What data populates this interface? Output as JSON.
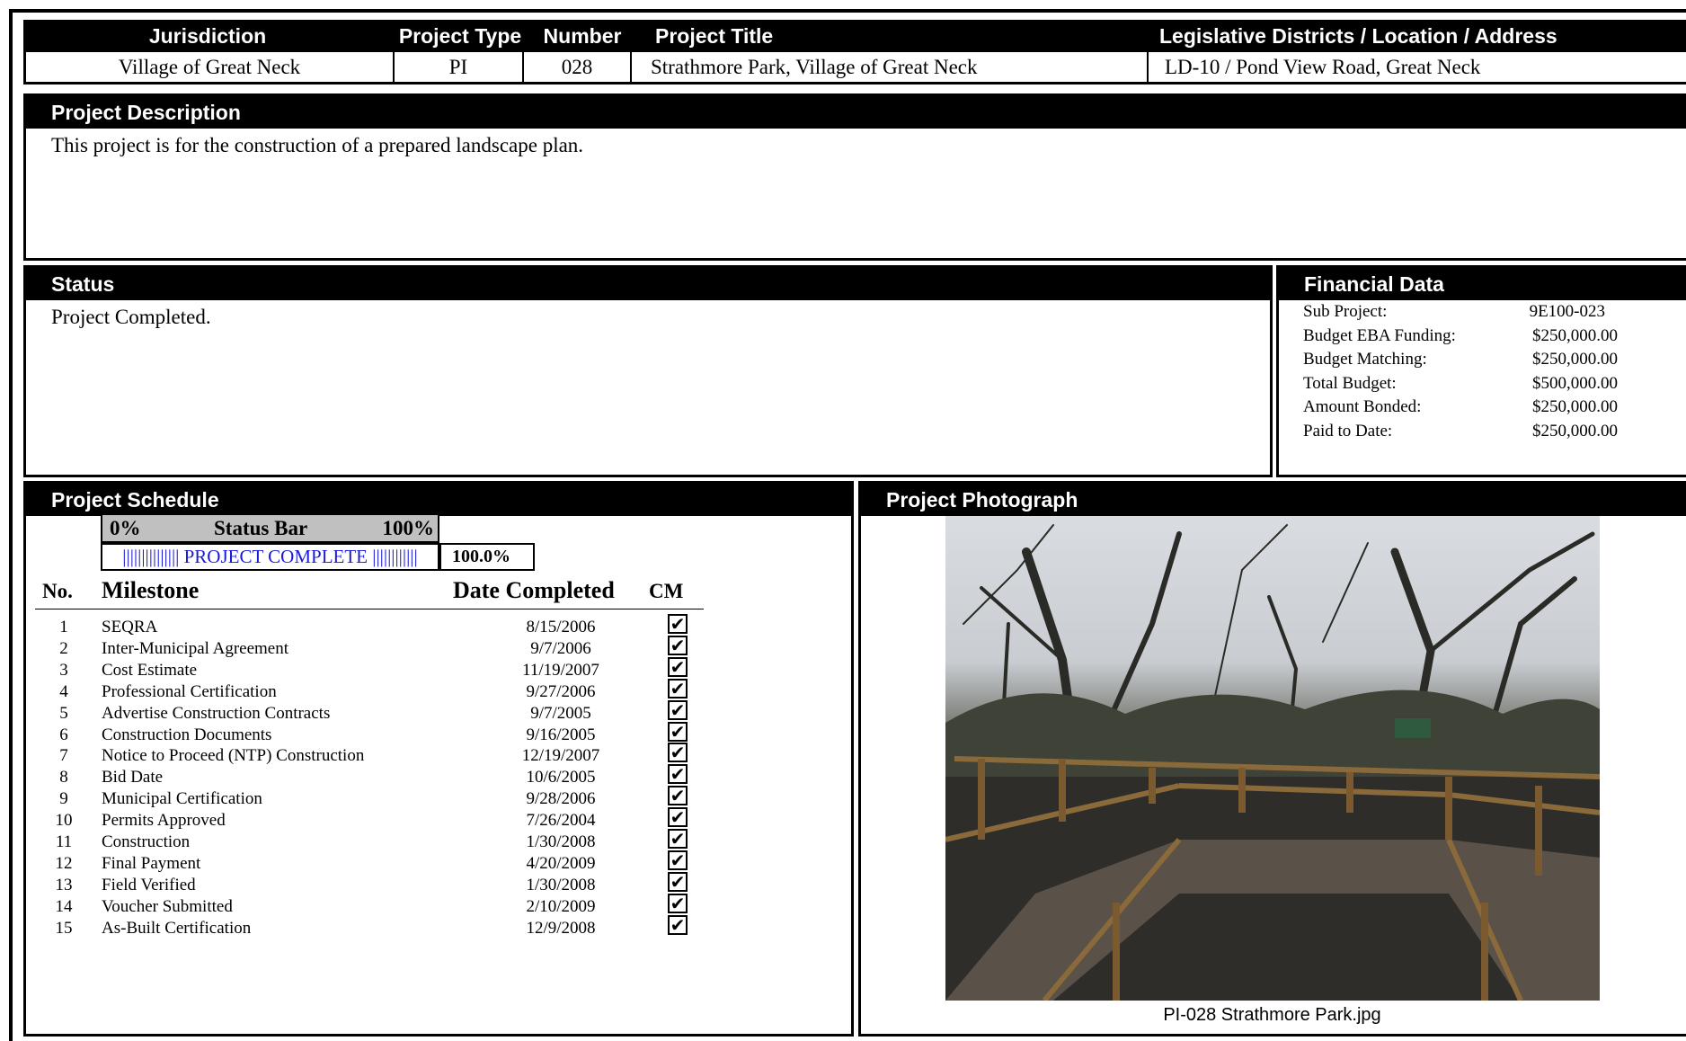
{
  "header": {
    "jurisdiction_label": "Jurisdiction",
    "project_type_label": "Project Type",
    "number_label": "Number",
    "project_title_label": "Project Title",
    "location_label": "Legislative Districts / Location / Address",
    "jurisdiction": "Village of Great Neck",
    "project_type": "PI",
    "number": "028",
    "project_title": "Strathmore Park, Village of Great Neck",
    "location": "LD-10 / Pond View Road, Great Neck"
  },
  "description": {
    "title": "Project Description",
    "text": "This project is for the construction of a prepared landscape plan."
  },
  "status": {
    "title": "Status",
    "text": "Project Completed."
  },
  "financial": {
    "title": "Financial Data",
    "rows": [
      {
        "label": "Sub Project:",
        "value": "9E100-023"
      },
      {
        "label": "Budget EBA Funding:",
        "value": "$250,000.00"
      },
      {
        "label": "Budget Matching:",
        "value": "$250,000.00"
      },
      {
        "label": "Total Budget:",
        "value": "$500,000.00"
      },
      {
        "label": "Amount Bonded:",
        "value": "$250,000.00"
      },
      {
        "label": "Paid to Date:",
        "value": "$250,000.00"
      }
    ]
  },
  "schedule": {
    "title": "Project Schedule",
    "status_bar": {
      "min_label": "0%",
      "label": "Status Bar",
      "max_label": "100%",
      "progress_text": "||||||||||||||| PROJECT COMPLETE ||||||||||||",
      "percent": "100.0%",
      "fraction": 1.0
    },
    "columns": {
      "no": "No.",
      "milestone": "Milestone",
      "date": "Date Completed",
      "cm": "CM"
    },
    "check_glyph": "✔",
    "milestones": [
      {
        "no": "1",
        "name": "SEQRA",
        "date": "8/15/2006",
        "cm": true
      },
      {
        "no": "2",
        "name": "Inter-Municipal Agreement",
        "date": "9/7/2006",
        "cm": true
      },
      {
        "no": "3",
        "name": "Cost Estimate",
        "date": "11/19/2007",
        "cm": true
      },
      {
        "no": "4",
        "name": "Professional Certification",
        "date": "9/27/2006",
        "cm": true
      },
      {
        "no": "5",
        "name": "Advertise Construction Contracts",
        "date": "9/7/2005",
        "cm": true
      },
      {
        "no": "6",
        "name": "Construction Documents",
        "date": "9/16/2005",
        "cm": true
      },
      {
        "no": "7",
        "name": "Notice to Proceed (NTP) Construction",
        "date": "12/19/2007",
        "cm": true
      },
      {
        "no": "8",
        "name": "Bid Date",
        "date": "10/6/2005",
        "cm": true
      },
      {
        "no": "9",
        "name": "Municipal Certification",
        "date": "9/28/2006",
        "cm": true
      },
      {
        "no": "10",
        "name": "Permits Approved",
        "date": "7/26/2004",
        "cm": true
      },
      {
        "no": "11",
        "name": "Construction",
        "date": "1/30/2008",
        "cm": true
      },
      {
        "no": "12",
        "name": "Final Payment",
        "date": "4/20/2009",
        "cm": true
      },
      {
        "no": "13",
        "name": "Field Verified",
        "date": "1/30/2008",
        "cm": true
      },
      {
        "no": "14",
        "name": "Voucher Submitted",
        "date": "2/10/2009",
        "cm": true
      },
      {
        "no": "15",
        "name": "As-Built Certification",
        "date": "12/9/2008",
        "cm": true
      }
    ]
  },
  "photo": {
    "title": "Project Photograph",
    "caption": "PI-028 Strathmore Park.jpg"
  }
}
